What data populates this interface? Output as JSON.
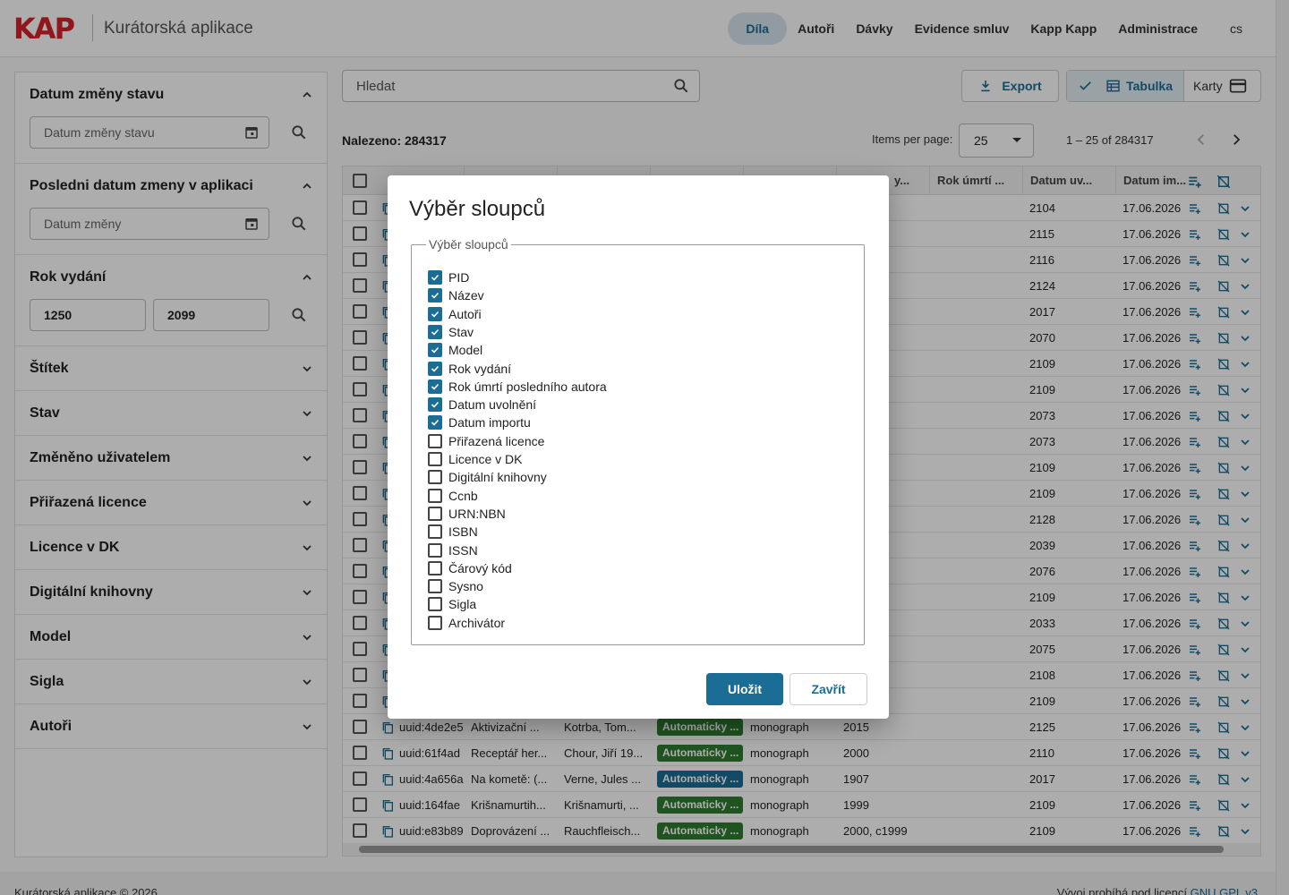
{
  "header": {
    "logo_text": "KAP",
    "app_title": "Kurátorská aplikace",
    "nav": [
      "Díla",
      "Autoři",
      "Dávky",
      "Evidence smluv",
      "Kapp Kapp",
      "Administrace"
    ],
    "nav_active_index": 0,
    "lang": "cs"
  },
  "sidebar": {
    "facets": [
      {
        "label": "Datum změny stavu",
        "expanded": true,
        "input_placeholder": "Datum změny stavu"
      },
      {
        "label": "Posledni datum zmeny v aplikaci",
        "expanded": true,
        "input_placeholder": "Datum změny"
      },
      {
        "label": "Rok vydání",
        "expanded": true,
        "from": "1250",
        "to": "2099"
      },
      {
        "label": "Štítek",
        "expanded": false
      },
      {
        "label": "Stav",
        "expanded": false
      },
      {
        "label": "Změněno uživatelem",
        "expanded": false
      },
      {
        "label": "Přiřazená licence",
        "expanded": false
      },
      {
        "label": "Licence v DK",
        "expanded": false
      },
      {
        "label": "Digitální knihovny",
        "expanded": false
      },
      {
        "label": "Model",
        "expanded": false
      },
      {
        "label": "Sigla",
        "expanded": false
      },
      {
        "label": "Autoři",
        "expanded": false
      }
    ]
  },
  "toolbar": {
    "search_placeholder": "Hledat",
    "export_label": "Export",
    "view_table_label": "Tabulka",
    "view_cards_label": "Karty",
    "found_label": "Nalezeno: 284317",
    "items_per_page_label": "Items per page:",
    "items_per_page_value": "25",
    "range_label": "1 – 25 of 284317"
  },
  "table": {
    "visible_headers": [
      "Rok úmrtí ...",
      "Datum uv...",
      "Datum im..."
    ],
    "partial_header": "y...",
    "top_rows": [
      {
        "rok_umrti": "",
        "datum_uvolneni": "2104",
        "datum_importu": "17.06.2026"
      },
      {
        "rok_umrti": "",
        "datum_uvolneni": "2115",
        "datum_importu": "17.06.2026"
      },
      {
        "rok_umrti": "",
        "datum_uvolneni": "2116",
        "datum_importu": "17.06.2026"
      },
      {
        "rok_umrti": "",
        "datum_uvolneni": "2124",
        "datum_importu": "17.06.2026"
      },
      {
        "rok_umrti": "",
        "datum_uvolneni": "2017",
        "datum_importu": "17.06.2026"
      },
      {
        "rok_umrti": "",
        "datum_uvolneni": "2070",
        "datum_importu": "17.06.2026"
      },
      {
        "rok_umrti": "",
        "datum_uvolneni": "2109",
        "datum_importu": "17.06.2026"
      },
      {
        "rok_umrti": "",
        "datum_uvolneni": "2109",
        "datum_importu": "17.06.2026"
      },
      {
        "rok_umrti": "",
        "datum_uvolneni": "2073",
        "datum_importu": "17.06.2026"
      },
      {
        "rok_umrti": "",
        "datum_uvolneni": "2073",
        "datum_importu": "17.06.2026"
      },
      {
        "rok_umrti": "",
        "datum_uvolneni": "2109",
        "datum_importu": "17.06.2026"
      },
      {
        "rok_umrti": "",
        "datum_uvolneni": "2109",
        "datum_importu": "17.06.2026"
      },
      {
        "rok_umrti": "",
        "datum_uvolneni": "2128",
        "datum_importu": "17.06.2026"
      },
      {
        "rok_umrti": "",
        "datum_uvolneni": "2039",
        "datum_importu": "17.06.2026"
      },
      {
        "rok_umrti": "",
        "datum_uvolneni": "2076",
        "datum_importu": "17.06.2026"
      },
      {
        "rok_umrti": "",
        "datum_uvolneni": "2109",
        "datum_importu": "17.06.2026"
      },
      {
        "rok_umrti": "",
        "datum_uvolneni": "2033",
        "datum_importu": "17.06.2026"
      },
      {
        "rok_umrti": "",
        "datum_uvolneni": "2075",
        "datum_importu": "17.06.2026"
      },
      {
        "rok_umrti": "",
        "datum_uvolneni": "2108",
        "datum_importu": "17.06.2026"
      },
      {
        "rok_umrti": "",
        "datum_uvolneni": "2109",
        "datum_importu": "17.06.2026"
      }
    ],
    "bottom_rows": [
      {
        "pid": "uuid:4de2e5",
        "nazev": "Aktivizační ...",
        "autori": "Kotrba, Tom...",
        "stav": "Automaticky ...",
        "stav_color": "green",
        "model": "monograph",
        "rok_vydani": "2015",
        "datum_uvolneni": "2125",
        "datum_importu": "17.06.2026"
      },
      {
        "pid": "uuid:61f4ad",
        "nazev": "Receptář her...",
        "autori": "Chour, Jiří 19...",
        "stav": "Automaticky ...",
        "stav_color": "green",
        "model": "monograph",
        "rok_vydani": "2000",
        "datum_uvolneni": "2110",
        "datum_importu": "17.06.2026"
      },
      {
        "pid": "uuid:4a656a",
        "nazev": "Na kometě: (...",
        "autori": "Verne, Jules ...",
        "stav": "Automaticky ...",
        "stav_color": "blue",
        "model": "monograph",
        "rok_vydani": "1907",
        "datum_uvolneni": "2017",
        "datum_importu": "17.06.2026"
      },
      {
        "pid": "uuid:164fae",
        "nazev": "Krišnamurtih...",
        "autori": "Krišnamurti, ...",
        "stav": "Automaticky ...",
        "stav_color": "green",
        "model": "monograph",
        "rok_vydani": "1999",
        "datum_uvolneni": "2109",
        "datum_importu": "17.06.2026"
      },
      {
        "pid": "uuid:e83b89",
        "nazev": "Doprovázení ...",
        "autori": "Rauchfleisch...",
        "stav": "Automaticky ...",
        "stav_color": "green",
        "model": "monograph",
        "rok_vydani": "2000, c1999",
        "datum_uvolneni": "2109",
        "datum_importu": "17.06.2026"
      }
    ]
  },
  "dialog": {
    "title": "Výběr sloupců",
    "legend": "Výběr sloupců",
    "options": [
      {
        "label": "PID",
        "checked": true
      },
      {
        "label": "Název",
        "checked": true
      },
      {
        "label": "Autoři",
        "checked": true
      },
      {
        "label": "Stav",
        "checked": true
      },
      {
        "label": "Model",
        "checked": true
      },
      {
        "label": "Rok vydání",
        "checked": true
      },
      {
        "label": "Rok úmrtí posledního autora",
        "checked": true
      },
      {
        "label": "Datum uvolnění",
        "checked": true
      },
      {
        "label": "Datum importu",
        "checked": true
      },
      {
        "label": "Přiřazená licence",
        "checked": false
      },
      {
        "label": "Licence v DK",
        "checked": false
      },
      {
        "label": "Digitální knihovny",
        "checked": false
      },
      {
        "label": "Ccnb",
        "checked": false
      },
      {
        "label": "URN:NBN",
        "checked": false
      },
      {
        "label": "ISBN",
        "checked": false
      },
      {
        "label": "ISSN",
        "checked": false
      },
      {
        "label": "Čárový kód",
        "checked": false
      },
      {
        "label": "Sysno",
        "checked": false
      },
      {
        "label": "Sigla",
        "checked": false
      },
      {
        "label": "Archivátor",
        "checked": false
      }
    ],
    "save_label": "Uložit",
    "close_label": "Zavřít"
  },
  "footer": {
    "left": "Kurátorská aplikace © 2026",
    "right_prefix": "Vývoj probíhá pod licencí",
    "right_link": "GNU GPL v3"
  },
  "colors": {
    "accent": "#1a6e96",
    "badge_green": "#2e7d32",
    "logo_red": "#d8232a"
  }
}
